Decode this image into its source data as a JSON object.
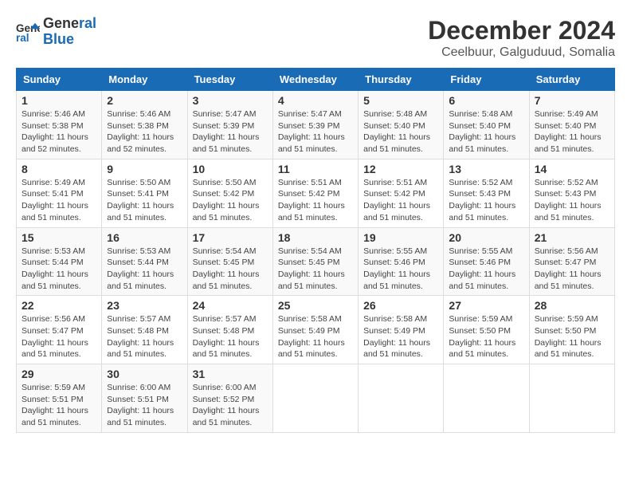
{
  "logo": {
    "line1": "General",
    "line2": "Blue"
  },
  "title": "December 2024",
  "subtitle": "Ceelbuur, Galguduud, Somalia",
  "weekdays": [
    "Sunday",
    "Monday",
    "Tuesday",
    "Wednesday",
    "Thursday",
    "Friday",
    "Saturday"
  ],
  "weeks": [
    [
      {
        "day": "1",
        "rise": "5:46 AM",
        "set": "5:38 PM",
        "hours": "11",
        "mins": "52"
      },
      {
        "day": "2",
        "rise": "5:46 AM",
        "set": "5:38 PM",
        "hours": "11",
        "mins": "52"
      },
      {
        "day": "3",
        "rise": "5:47 AM",
        "set": "5:39 PM",
        "hours": "11",
        "mins": "51"
      },
      {
        "day": "4",
        "rise": "5:47 AM",
        "set": "5:39 PM",
        "hours": "11",
        "mins": "51"
      },
      {
        "day": "5",
        "rise": "5:48 AM",
        "set": "5:40 PM",
        "hours": "11",
        "mins": "51"
      },
      {
        "day": "6",
        "rise": "5:48 AM",
        "set": "5:40 PM",
        "hours": "11",
        "mins": "51"
      },
      {
        "day": "7",
        "rise": "5:49 AM",
        "set": "5:40 PM",
        "hours": "11",
        "mins": "51"
      }
    ],
    [
      {
        "day": "8",
        "rise": "5:49 AM",
        "set": "5:41 PM",
        "hours": "11",
        "mins": "51"
      },
      {
        "day": "9",
        "rise": "5:50 AM",
        "set": "5:41 PM",
        "hours": "11",
        "mins": "51"
      },
      {
        "day": "10",
        "rise": "5:50 AM",
        "set": "5:42 PM",
        "hours": "11",
        "mins": "51"
      },
      {
        "day": "11",
        "rise": "5:51 AM",
        "set": "5:42 PM",
        "hours": "11",
        "mins": "51"
      },
      {
        "day": "12",
        "rise": "5:51 AM",
        "set": "5:42 PM",
        "hours": "11",
        "mins": "51"
      },
      {
        "day": "13",
        "rise": "5:52 AM",
        "set": "5:43 PM",
        "hours": "11",
        "mins": "51"
      },
      {
        "day": "14",
        "rise": "5:52 AM",
        "set": "5:43 PM",
        "hours": "11",
        "mins": "51"
      }
    ],
    [
      {
        "day": "15",
        "rise": "5:53 AM",
        "set": "5:44 PM",
        "hours": "11",
        "mins": "51"
      },
      {
        "day": "16",
        "rise": "5:53 AM",
        "set": "5:44 PM",
        "hours": "11",
        "mins": "51"
      },
      {
        "day": "17",
        "rise": "5:54 AM",
        "set": "5:45 PM",
        "hours": "11",
        "mins": "51"
      },
      {
        "day": "18",
        "rise": "5:54 AM",
        "set": "5:45 PM",
        "hours": "11",
        "mins": "51"
      },
      {
        "day": "19",
        "rise": "5:55 AM",
        "set": "5:46 PM",
        "hours": "11",
        "mins": "51"
      },
      {
        "day": "20",
        "rise": "5:55 AM",
        "set": "5:46 PM",
        "hours": "11",
        "mins": "51"
      },
      {
        "day": "21",
        "rise": "5:56 AM",
        "set": "5:47 PM",
        "hours": "11",
        "mins": "51"
      }
    ],
    [
      {
        "day": "22",
        "rise": "5:56 AM",
        "set": "5:47 PM",
        "hours": "11",
        "mins": "51"
      },
      {
        "day": "23",
        "rise": "5:57 AM",
        "set": "5:48 PM",
        "hours": "11",
        "mins": "51"
      },
      {
        "day": "24",
        "rise": "5:57 AM",
        "set": "5:48 PM",
        "hours": "11",
        "mins": "51"
      },
      {
        "day": "25",
        "rise": "5:58 AM",
        "set": "5:49 PM",
        "hours": "11",
        "mins": "51"
      },
      {
        "day": "26",
        "rise": "5:58 AM",
        "set": "5:49 PM",
        "hours": "11",
        "mins": "51"
      },
      {
        "day": "27",
        "rise": "5:59 AM",
        "set": "5:50 PM",
        "hours": "11",
        "mins": "51"
      },
      {
        "day": "28",
        "rise": "5:59 AM",
        "set": "5:50 PM",
        "hours": "11",
        "mins": "51"
      }
    ],
    [
      {
        "day": "29",
        "rise": "5:59 AM",
        "set": "5:51 PM",
        "hours": "11",
        "mins": "51"
      },
      {
        "day": "30",
        "rise": "6:00 AM",
        "set": "5:51 PM",
        "hours": "11",
        "mins": "51"
      },
      {
        "day": "31",
        "rise": "6:00 AM",
        "set": "5:52 PM",
        "hours": "11",
        "mins": "51"
      },
      null,
      null,
      null,
      null
    ]
  ]
}
